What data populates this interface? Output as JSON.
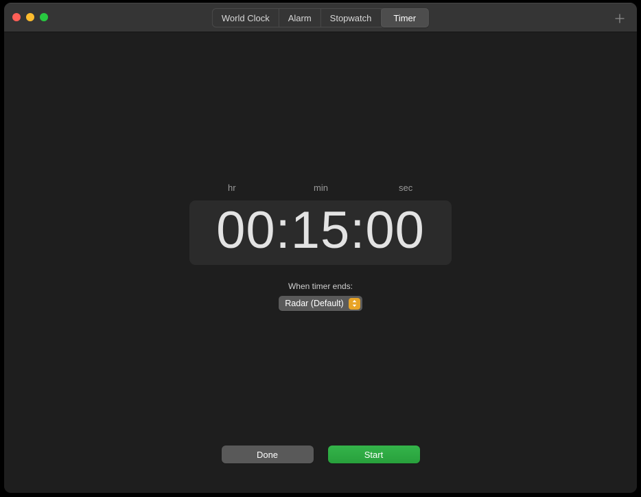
{
  "window": {
    "traffic_lights": [
      {
        "name": "close",
        "color": "#ff5f57"
      },
      {
        "name": "minimize",
        "color": "#febc2e"
      },
      {
        "name": "maximize",
        "color": "#28c840"
      }
    ]
  },
  "toolbar": {
    "tabs": [
      {
        "label": "World Clock",
        "selected": false
      },
      {
        "label": "Alarm",
        "selected": false
      },
      {
        "label": "Stopwatch",
        "selected": false
      },
      {
        "label": "Timer",
        "selected": true
      }
    ],
    "add_icon": "plus-icon"
  },
  "timer": {
    "unit_labels": {
      "hours": "hr",
      "minutes": "min",
      "seconds": "sec"
    },
    "display": "00:15:00",
    "hours": "00",
    "minutes": "15",
    "seconds": "00",
    "when_ends_label": "When timer ends:",
    "sound": {
      "selected": "Radar (Default)",
      "stepper_icon": "chevron-up-down-icon",
      "stepper_color": "#e8a427"
    }
  },
  "actions": {
    "done_label": "Done",
    "start_label": "Start",
    "start_color": "#2faa45",
    "done_color": "#595959"
  }
}
